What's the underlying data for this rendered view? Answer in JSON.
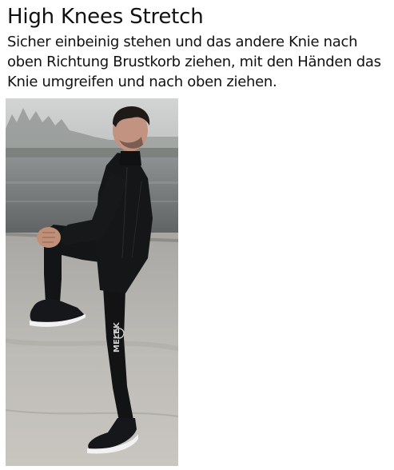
{
  "exercise": {
    "title": "High Knees Stretch",
    "description": "Sicher einbeinig stehen und das andere Knie nach oben Richtung Brustkorb ziehen, mit den Händen das Knie umgreifen und nach oben ziehen.",
    "photo_logo_text": "MELEK"
  },
  "colors": {
    "sky": "#c9cbcb",
    "water": "#737676",
    "ground": "#b8b6b1",
    "clothing": "#131416",
    "skin": "#c08f78",
    "shoe_sole": "#f2f2f2"
  }
}
